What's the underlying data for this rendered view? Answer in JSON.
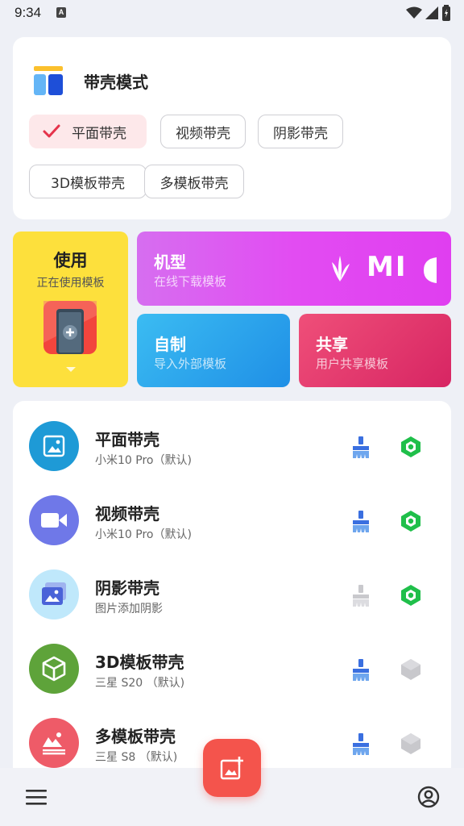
{
  "status": {
    "time": "9:34",
    "notif_letter": "A"
  },
  "mode": {
    "title": "带壳模式",
    "chips": [
      "平面带壳",
      "视频带壳",
      "阴影带壳",
      "3D模板带壳",
      "多模板带壳"
    ],
    "selected_index": 0
  },
  "tiles": {
    "use": {
      "title": "使用",
      "subtitle": "正在使用模板"
    },
    "model": {
      "title": "机型",
      "subtitle": "在线下载模板",
      "brand_text": "MI"
    },
    "diy": {
      "title": "自制",
      "subtitle": "导入外部模板"
    },
    "share": {
      "title": "共享",
      "subtitle": "用户共享模板"
    }
  },
  "list": [
    {
      "title": "平面带壳",
      "subtitle": "小米10 Pro（默认)",
      "icon": "image-icon",
      "color": "#1e9ad6",
      "clean_enabled": true,
      "hex_active": true
    },
    {
      "title": "视频带壳",
      "subtitle": "小米10 Pro（默认)",
      "icon": "video-icon",
      "color": "#6f78e8",
      "clean_enabled": true,
      "hex_active": true
    },
    {
      "title": "阴影带壳",
      "subtitle": "图片添加阴影",
      "icon": "shadow-image-icon",
      "color": "#bfe8fb",
      "clean_enabled": false,
      "hex_active": true
    },
    {
      "title": "3D模板带壳",
      "subtitle": "三星 S20 （默认)",
      "icon": "cube-icon",
      "color": "#5ea33a",
      "clean_enabled": true,
      "hex_active": false
    },
    {
      "title": "多模板带壳",
      "subtitle": "三星 S8 （默认)",
      "icon": "multi-template-icon",
      "color": "#ee5b68",
      "clean_enabled": true,
      "hex_active": false
    }
  ],
  "colors": {
    "accent": "#f4544c",
    "selected_chip_bg": "#fde8ea",
    "active_hex": "#1fbf4a",
    "inactive_hex": "#c8c8cc",
    "broom_active": "#3a6fe0",
    "broom_inactive": "#c9c9cd"
  }
}
